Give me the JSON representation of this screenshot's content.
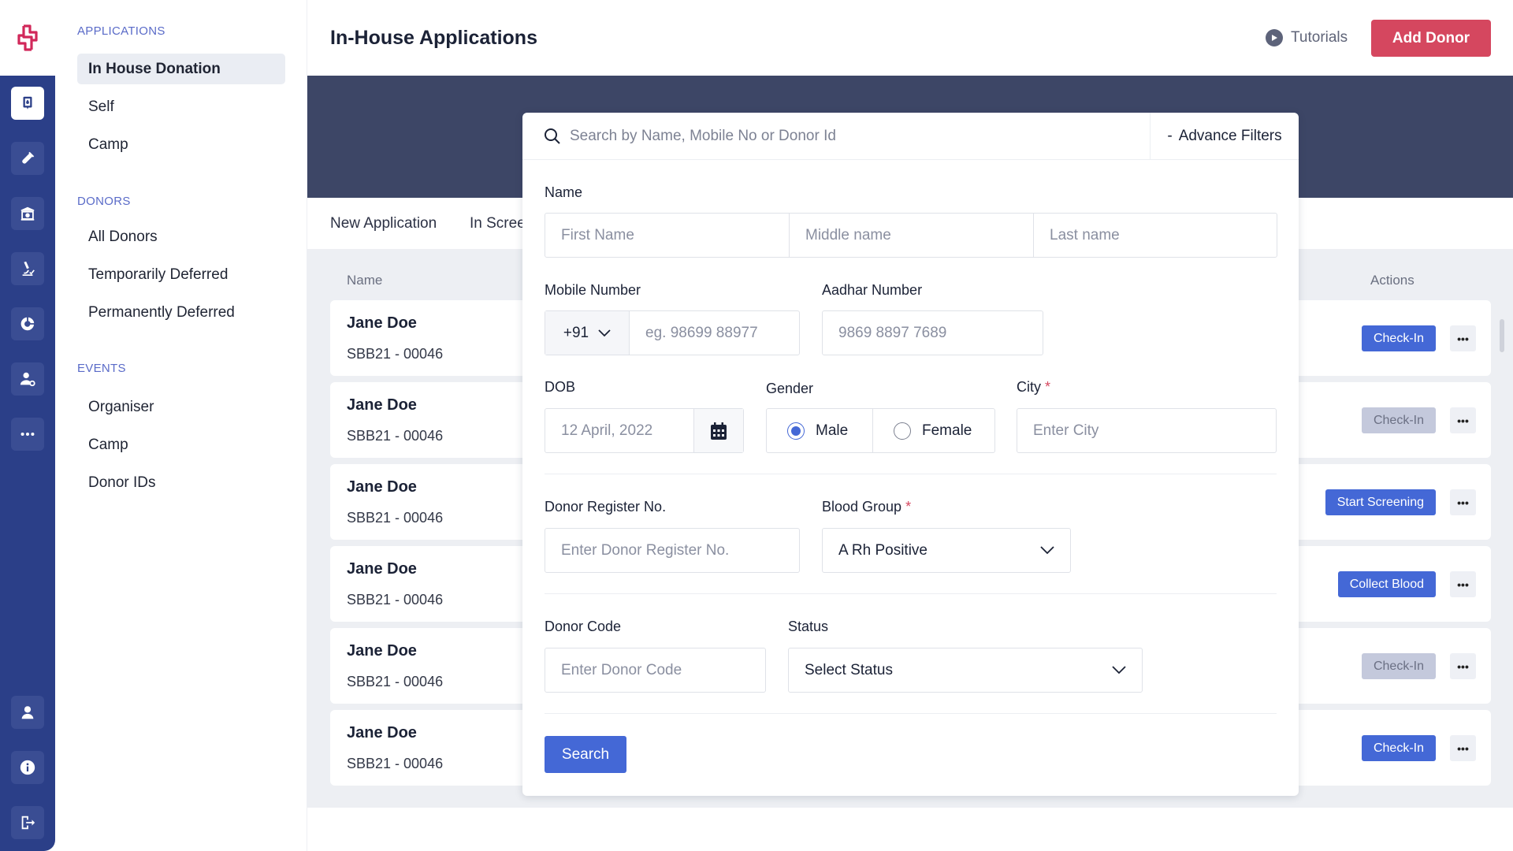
{
  "brand": {
    "logo_icon": "medical-cross-logo",
    "accent_color": "#d5475f",
    "primary_color": "#4468d6",
    "rail_color": "#2b3f88",
    "banner_color": "#3d4666"
  },
  "rail": {
    "top_icons": [
      {
        "name": "blood-bag-icon",
        "active": true
      },
      {
        "name": "test-tube-icon",
        "active": false
      },
      {
        "name": "blood-bank-icon",
        "active": false
      },
      {
        "name": "microscope-icon",
        "active": false
      },
      {
        "name": "pie-chart-icon",
        "active": false
      },
      {
        "name": "user-settings-icon",
        "active": false
      },
      {
        "name": "more-icon",
        "active": false
      }
    ],
    "bottom_icons": [
      {
        "name": "user-icon"
      },
      {
        "name": "info-icon"
      },
      {
        "name": "logout-icon"
      }
    ]
  },
  "nav": {
    "sections": [
      {
        "title": "APPLICATIONS",
        "items": [
          {
            "label": "In House Donation",
            "active": true
          },
          {
            "label": "Self",
            "active": false
          },
          {
            "label": "Camp",
            "active": false
          }
        ]
      },
      {
        "title": "DONORS",
        "items": [
          {
            "label": "All Donors",
            "active": false
          },
          {
            "label": "Temporarily Deferred",
            "active": false
          },
          {
            "label": "Permanently Deferred",
            "active": false
          }
        ]
      },
      {
        "title": "EVENTS",
        "items": [
          {
            "label": "Organiser",
            "active": false
          },
          {
            "label": "Camp",
            "active": false
          },
          {
            "label": "Donor IDs",
            "active": false
          }
        ]
      }
    ]
  },
  "header": {
    "title": "In-House Applications",
    "tutorials_label": "Tutorials",
    "add_donor_label": "Add Donor"
  },
  "tabs": [
    {
      "label": "New Application"
    },
    {
      "label": "In Scree"
    }
  ],
  "table": {
    "columns": {
      "name": "Name",
      "actions": "Actions"
    },
    "rows": [
      {
        "name": "Jane Doe",
        "id": "SBB21 - 00046",
        "action": "Check-In",
        "action_enabled": true
      },
      {
        "name": "Jane Doe",
        "id": "SBB21 - 00046",
        "action": "Check-In",
        "action_enabled": false
      },
      {
        "name": "Jane Doe",
        "id": "SBB21 - 00046",
        "action": "Start Screening",
        "action_enabled": true
      },
      {
        "name": "Jane Doe",
        "id": "SBB21 - 00046",
        "action": "Collect Blood",
        "action_enabled": true
      },
      {
        "name": "Jane Doe",
        "id": "SBB21 - 00046",
        "action": "Check-In",
        "action_enabled": false
      },
      {
        "name": "Jane Doe",
        "id": "SBB21 - 00046",
        "action": "Check-In",
        "action_enabled": true
      }
    ],
    "more_label": "•••"
  },
  "filters": {
    "search_placeholder": "Search by Name, Mobile No or Donor Id",
    "advance_filters_label": "Advance Filters",
    "advance_filters_prefix": "-",
    "name_label": "Name",
    "first_name_placeholder": "First Name",
    "middle_name_placeholder": "Middle name",
    "last_name_placeholder": "Last name",
    "mobile_label": "Mobile Number",
    "country_code": "+91",
    "mobile_placeholder": "eg. 98699 88977",
    "aadhar_label": "Aadhar Number",
    "aadhar_placeholder": "9869 8897 7689",
    "dob_label": "DOB",
    "dob_placeholder": "12 April, 2022",
    "gender_label": "Gender",
    "gender_options": [
      {
        "label": "Male",
        "selected": true
      },
      {
        "label": "Female",
        "selected": false
      }
    ],
    "city_label": "City",
    "city_placeholder": "Enter City",
    "required_mark": "*",
    "donor_register_label": "Donor Register No.",
    "donor_register_placeholder": "Enter Donor Register No.",
    "blood_group_label": "Blood Group",
    "blood_group_value": "A Rh Positive",
    "donor_code_label": "Donor Code",
    "donor_code_placeholder": "Enter Donor Code",
    "status_label": "Status",
    "status_value": "Select Status",
    "search_button": "Search"
  }
}
